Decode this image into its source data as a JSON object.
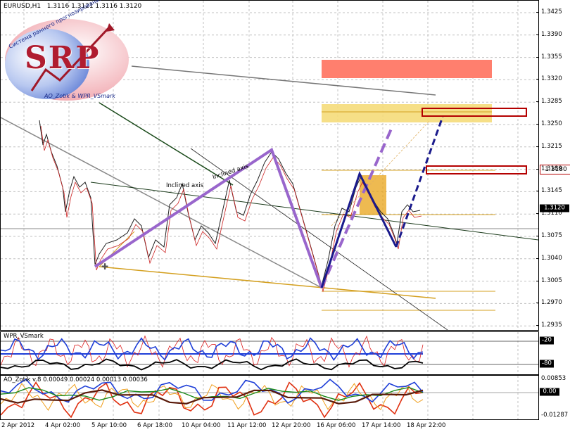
{
  "header": {
    "symbol_timeframe": "EURUSD,H1",
    "ohlc": "1.3116 1.3121 1.3116 1.3120"
  },
  "logo": {
    "text": "SRP",
    "arc_text": "Система раннего прогнозирования",
    "bottom_text": "AO_Zotik & WPR_VSmark"
  },
  "main_chart": {
    "price_labels": [
      "1.3425",
      "1.3390",
      "1.3355",
      "1.3320",
      "1.3285",
      "1.3250",
      "1.3215",
      "1.3180",
      "1.3145",
      "1.3110",
      "1.3075",
      "1.3040",
      "1.3005",
      "1.2970",
      "1.2935"
    ],
    "current_price": "1.3120",
    "level_tag": "1.3180",
    "annotations": [
      "Inclined axis",
      "Inclined axis"
    ],
    "colors": {
      "pattern_purple": "#9966cc",
      "pattern_navy": "#1a1a8c",
      "red_zone": "#ff7f6e",
      "yellow_zone": "#f5dc7a",
      "orange_box": "#e8a317"
    }
  },
  "wpr_panel": {
    "title": "WPR_VSmark",
    "levels": [
      "-20",
      "-80"
    ]
  },
  "ao_panel": {
    "title": "AO_Zotik v.8 0.00049 0.00024 0.00013 0.00036",
    "levels": [
      "0.00853",
      "0.00",
      "-0.01287"
    ]
  },
  "x_axis": {
    "labels": [
      "2 Apr 2012",
      "4 Apr 02:00",
      "5 Apr 10:00",
      "6 Apr 18:00",
      "10 Apr 04:00",
      "11 Apr 12:00",
      "12 Apr 20:00",
      "16 Apr 06:00",
      "17 Apr 14:00",
      "18 Apr 22:00"
    ]
  }
}
